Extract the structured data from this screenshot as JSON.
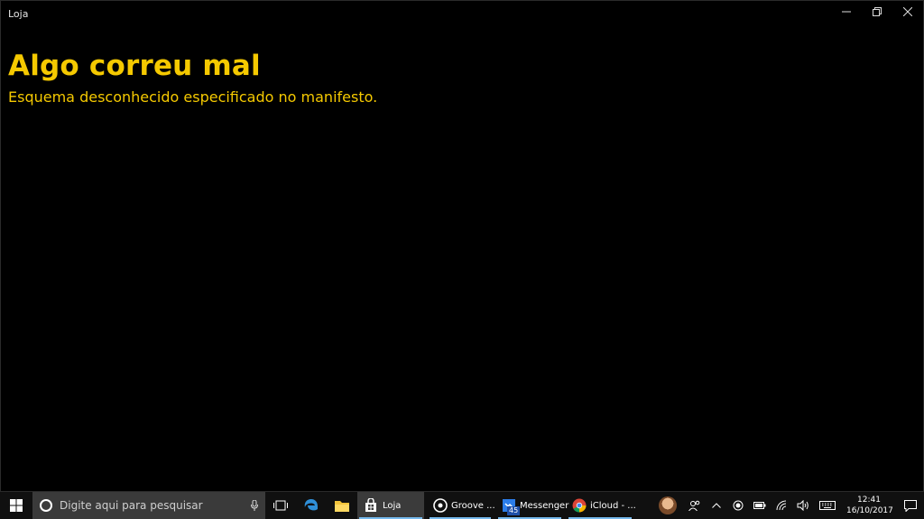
{
  "window": {
    "title": "Loja"
  },
  "error": {
    "title": "Algo correu mal",
    "message": "Esquema desconhecido especificado no manifesto."
  },
  "taskbar": {
    "search_placeholder": "Digite aqui para pesquisar",
    "apps": [
      {
        "label": "Loja",
        "icon": "store-icon",
        "active": true
      },
      {
        "label": "Groove ...",
        "icon": "groove-icon"
      },
      {
        "label": "Messenger",
        "icon": "messenger-icon",
        "badge": "45"
      },
      {
        "label": "iCloud - ...",
        "icon": "chrome-icon"
      }
    ],
    "clock": {
      "time": "12:41",
      "date": "16/10/2017"
    }
  },
  "colors": {
    "accent_text": "#f5c900",
    "taskbar_underline": "#76b9ed"
  }
}
